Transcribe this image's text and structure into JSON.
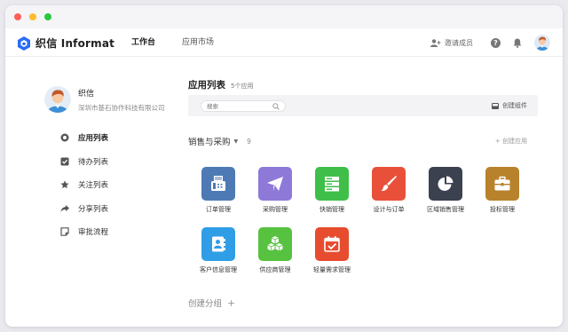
{
  "header": {
    "brand": "织信 Informat",
    "nav": [
      "工作台",
      "应用市场"
    ],
    "invite_label": "邀请成员",
    "help_symbol": "?"
  },
  "profile": {
    "name": "织信",
    "company": "深圳市基石协作科技有限公司"
  },
  "sidebar": {
    "items": [
      {
        "label": "应用列表",
        "icon": "grid-circle-icon",
        "active": true
      },
      {
        "label": "待办列表",
        "icon": "checkbox-icon",
        "active": false
      },
      {
        "label": "关注列表",
        "icon": "star-icon",
        "active": false
      },
      {
        "label": "分享列表",
        "icon": "share-icon",
        "active": false
      },
      {
        "label": "审批流程",
        "icon": "document-icon",
        "active": false
      }
    ]
  },
  "main": {
    "title": "应用列表",
    "count": "5个应用",
    "search_placeholder": "搜索",
    "create_component": "创建组件",
    "group": {
      "title": "销售与采购",
      "count": "9",
      "create_app": "+ 创建应用"
    },
    "apps": [
      {
        "label": "订单管理",
        "color": "#4d7ab4",
        "icon": "fax-icon"
      },
      {
        "label": "采购管理",
        "color": "#8e79d9",
        "icon": "paper-plane-icon"
      },
      {
        "label": "快销管理",
        "color": "#3fbf4a",
        "icon": "server-icon"
      },
      {
        "label": "设计与订单",
        "color": "#e9503a",
        "icon": "paintbrush-icon"
      },
      {
        "label": "区域销售管理",
        "color": "#3c4150",
        "icon": "pie-chart-icon"
      },
      {
        "label": "投标管理",
        "color": "#b8822c",
        "icon": "briefcase-icon"
      },
      {
        "label": "客户信息管理",
        "color": "#2f9ee6",
        "icon": "contact-book-icon"
      },
      {
        "label": "供应商管理",
        "color": "#56c240",
        "icon": "cubes-icon"
      },
      {
        "label": "轻量需求管理",
        "color": "#e74c2f",
        "icon": "calendar-check-icon"
      }
    ],
    "create_group": "创建分组"
  },
  "colors": {
    "brand_blue": "#2a6cf5",
    "accent_text": "#222222"
  }
}
